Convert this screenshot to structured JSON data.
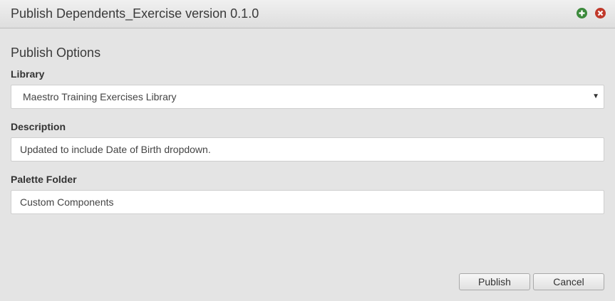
{
  "dialog": {
    "title": "Publish Dependents_Exercise version 0.1.0",
    "add_icon": "plus-circle-icon",
    "close_icon": "close-circle-icon",
    "colors": {
      "add": "#3c8a3c",
      "close": "#c0392b"
    }
  },
  "form": {
    "heading": "Publish Options",
    "library": {
      "label": "Library",
      "selected": "Maestro Training Exercises Library"
    },
    "description": {
      "label": "Description",
      "value": "Updated to include Date of Birth dropdown."
    },
    "palette_folder": {
      "label": "Palette Folder",
      "value": "Custom Components"
    }
  },
  "footer": {
    "publish_label": "Publish",
    "cancel_label": "Cancel"
  }
}
